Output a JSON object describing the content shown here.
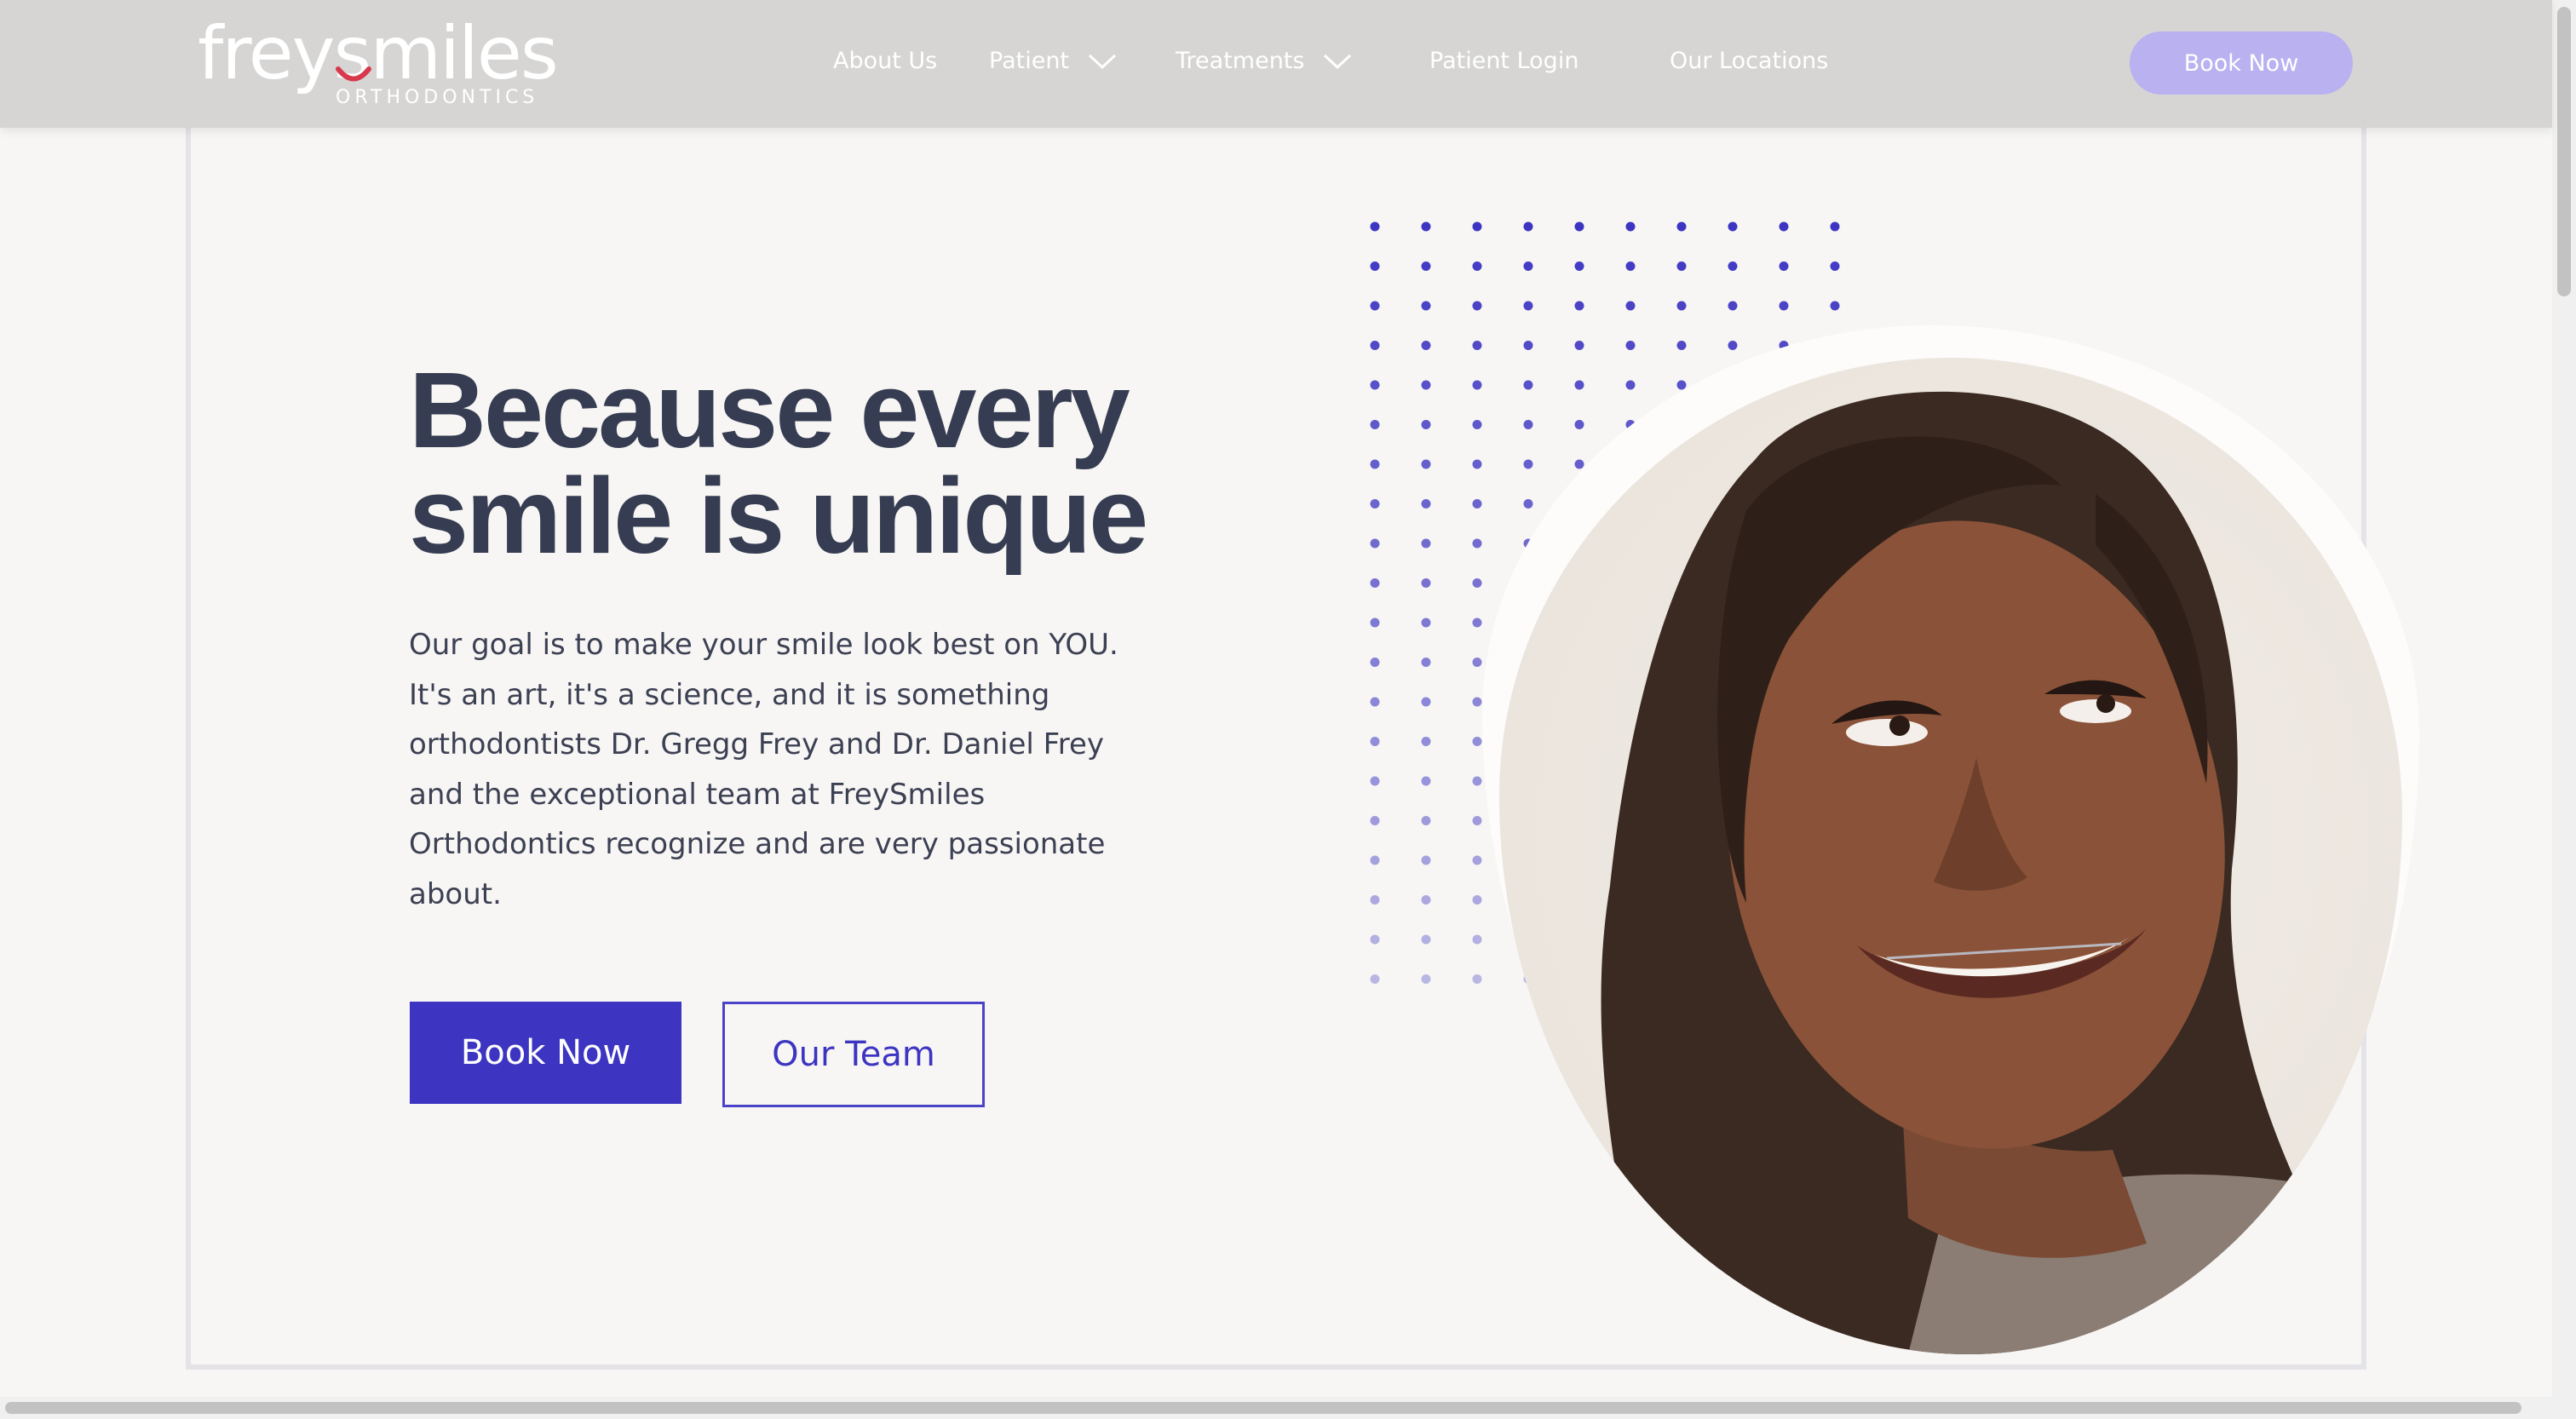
{
  "brand": {
    "name": "freysmiles",
    "tagline": "ORTHODONTICS",
    "smile_color": "#d8394d"
  },
  "nav": {
    "items": [
      {
        "label": "About Us",
        "has_dropdown": false
      },
      {
        "label": "Patient",
        "has_dropdown": true
      },
      {
        "label": "Treatments",
        "has_dropdown": true
      },
      {
        "label": "Patient Login",
        "has_dropdown": false
      },
      {
        "label": "Our Locations",
        "has_dropdown": false
      }
    ],
    "cta_label": "Book Now"
  },
  "hero": {
    "headline_line1": "Because every",
    "headline_line2": "smile is unique",
    "body_lines": [
      "Our goal is to make your smile look best on YOU.",
      "It's an art, it's a science, and it is something",
      "orthodontists Dr. Gregg Frey and Dr. Daniel Frey",
      "and the exceptional team at FreySmiles",
      "Orthodontics recognize and are very passionate",
      "about."
    ],
    "primary_button": "Book Now",
    "secondary_button": "Our Team"
  },
  "colors": {
    "header_bg": "#d6d5d4",
    "page_bg": "#f7f6f4",
    "accent": "#3d35c2",
    "header_cta": "#b9b1f0",
    "headline": "#363d52",
    "dot": "#3d35c2"
  },
  "icons": {
    "dropdown": "chevron-down-icon"
  }
}
